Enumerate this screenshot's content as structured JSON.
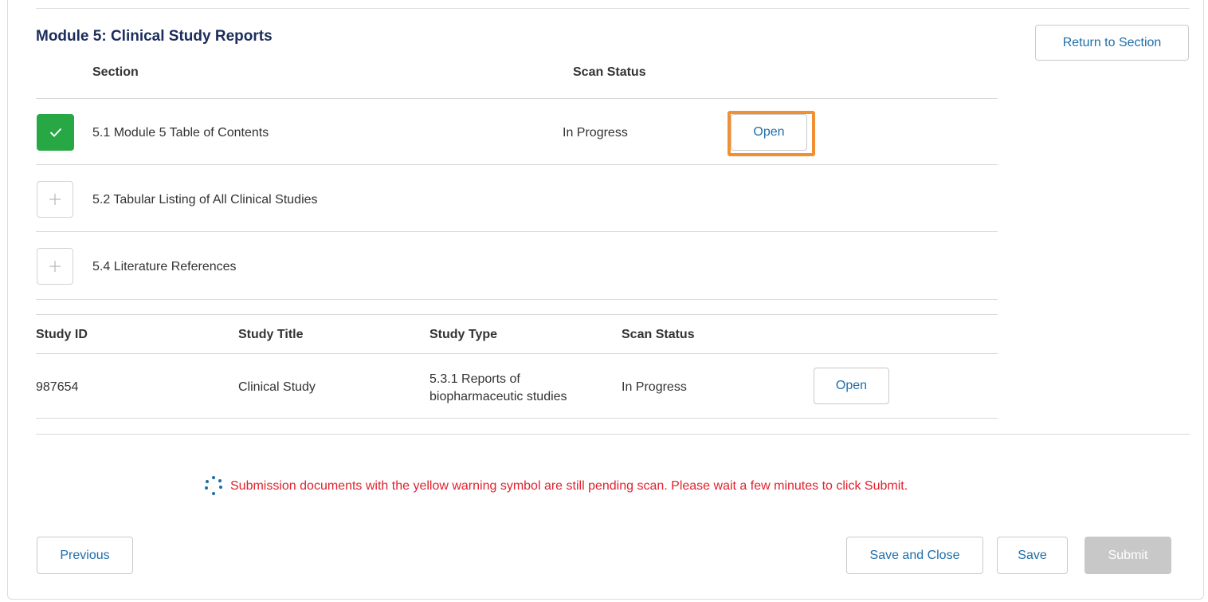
{
  "header": {
    "title": "Module 5: Clinical Study Reports",
    "return_label": "Return to Section"
  },
  "sections_table": {
    "columns": [
      "Section",
      "Scan Status"
    ],
    "rows": [
      {
        "label": "5.1 Module 5 Table of Contents",
        "status": "In Progress",
        "action": "Open",
        "state": "checked"
      },
      {
        "label": "5.2 Tabular Listing of All Clinical Studies",
        "state": "collapsed"
      },
      {
        "label": "5.4 Literature References",
        "state": "collapsed"
      }
    ]
  },
  "studies_table": {
    "columns": [
      "Study ID",
      "Study Title",
      "Study Type",
      "Scan Status"
    ],
    "rows": [
      {
        "id": "987654",
        "title": "Clinical Study",
        "type_line1": "5.3.1 Reports of",
        "type_line2": "biopharmaceutic studies",
        "status": "In Progress",
        "action": "Open"
      }
    ]
  },
  "warning": {
    "text": "Submission documents with the yellow warning symbol are still pending scan. Please wait a few minutes to click Submit.",
    "icon": "loading-spinner-icon",
    "color": "#e0222e"
  },
  "footer": {
    "previous_label": "Previous",
    "save_close_label": "Save and Close",
    "save_label": "Save",
    "submit_label": "Submit"
  },
  "colors": {
    "title": "#1b2d5b",
    "link": "#1f6ea8",
    "success": "#27a844",
    "highlight": "#f09033",
    "disabled": "#c8c8c8"
  }
}
